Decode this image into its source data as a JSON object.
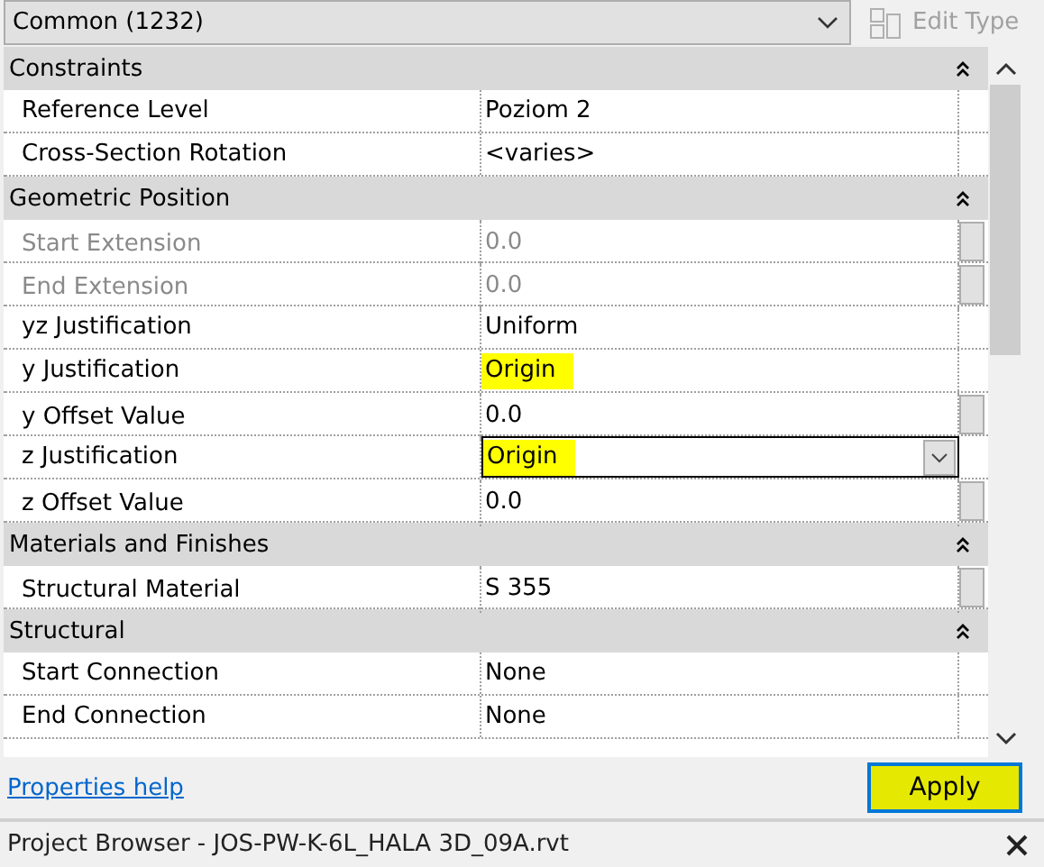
{
  "type_selector": {
    "value": "Common (1232)"
  },
  "edit_type_button": {
    "label": "Edit Type",
    "disabled": true
  },
  "groups": [
    {
      "title": "Constraints",
      "expanded": true,
      "rows": [
        {
          "label": "Reference Level",
          "value": "Poziom 2",
          "disabled": false,
          "kind": "text",
          "side_button": false,
          "highlighted": false
        },
        {
          "label": "Cross-Section Rotation",
          "value": "<varies>",
          "disabled": false,
          "kind": "text",
          "side_button": false,
          "highlighted": false
        }
      ]
    },
    {
      "title": "Geometric Position",
      "expanded": true,
      "rows": [
        {
          "label": "Start Extension",
          "value": "0.0",
          "disabled": true,
          "kind": "text",
          "side_button": true,
          "highlighted": false
        },
        {
          "label": "End Extension",
          "value": "0.0",
          "disabled": true,
          "kind": "text",
          "side_button": true,
          "highlighted": false
        },
        {
          "label": "yz Justification",
          "value": "Uniform",
          "disabled": false,
          "kind": "text",
          "side_button": false,
          "highlighted": false
        },
        {
          "label": "y Justification",
          "value": "Origin",
          "disabled": false,
          "kind": "text",
          "side_button": false,
          "highlighted": true
        },
        {
          "label": "y Offset Value",
          "value": "0.0",
          "disabled": false,
          "kind": "text",
          "side_button": true,
          "highlighted": false
        },
        {
          "label": "z Justification",
          "value": "Origin",
          "disabled": false,
          "kind": "dropdown",
          "side_button": false,
          "highlighted": true
        },
        {
          "label": "z Offset Value",
          "value": "0.0",
          "disabled": false,
          "kind": "text",
          "side_button": true,
          "highlighted": false
        }
      ]
    },
    {
      "title": "Materials and Finishes",
      "expanded": true,
      "rows": [
        {
          "label": "Structural Material",
          "value": "S 355",
          "disabled": false,
          "kind": "text",
          "side_button": true,
          "highlighted": false
        }
      ]
    },
    {
      "title": "Structural",
      "expanded": true,
      "rows": [
        {
          "label": "Start Connection",
          "value": "None",
          "disabled": false,
          "kind": "text",
          "side_button": false,
          "highlighted": false
        },
        {
          "label": "End Connection",
          "value": "None",
          "disabled": false,
          "kind": "text",
          "side_button": false,
          "highlighted": false
        }
      ]
    }
  ],
  "help_link": "Properties help",
  "apply_button": {
    "label": "Apply",
    "highlighted": true
  },
  "project_browser": {
    "title": "Project Browser - JOS-PW-K-6L_HALA 3D_09A.rvt"
  }
}
